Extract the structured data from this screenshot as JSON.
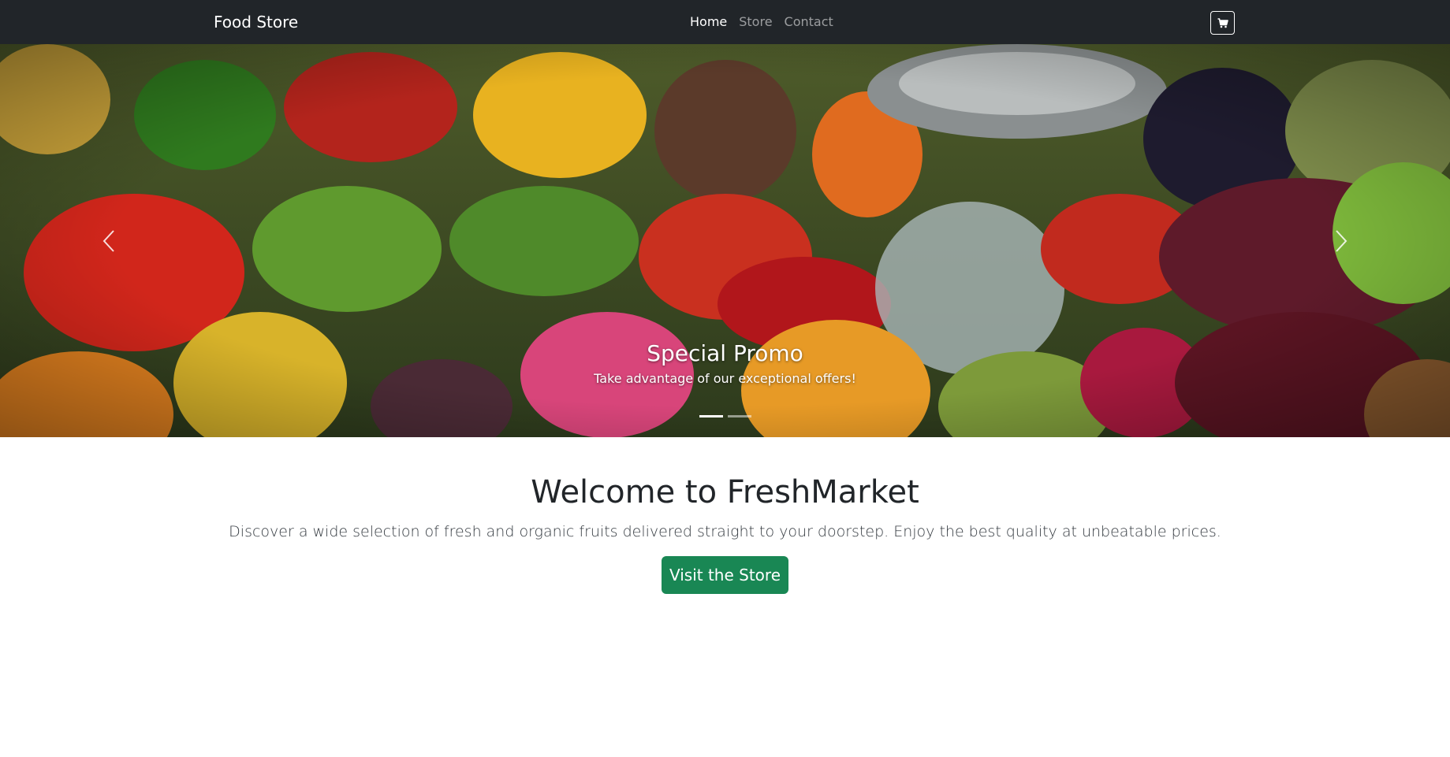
{
  "navbar": {
    "brand": "Food Store",
    "links": [
      {
        "label": "Home",
        "active": true
      },
      {
        "label": "Store",
        "active": false
      },
      {
        "label": "Contact",
        "active": false
      }
    ],
    "cart_icon": "cart-icon"
  },
  "carousel": {
    "slide_image": "market-produce-photo",
    "caption_title": "Special Promo",
    "caption_text": "Take advantage of our exceptional offers!",
    "prev_icon": "chevron-left-icon",
    "next_icon": "chevron-right-icon",
    "indicator_count": 2,
    "active_indicator": 0
  },
  "hero": {
    "title": "Welcome to FreshMarket",
    "lead": "Discover a wide selection of fresh and organic fruits delivered straight to your doorstep. Enjoy the best quality at unbeatable prices.",
    "cta_label": "Visit the Store"
  },
  "colors": {
    "navbar_bg": "#212529",
    "cta_bg": "#198754",
    "text": "#212529"
  }
}
